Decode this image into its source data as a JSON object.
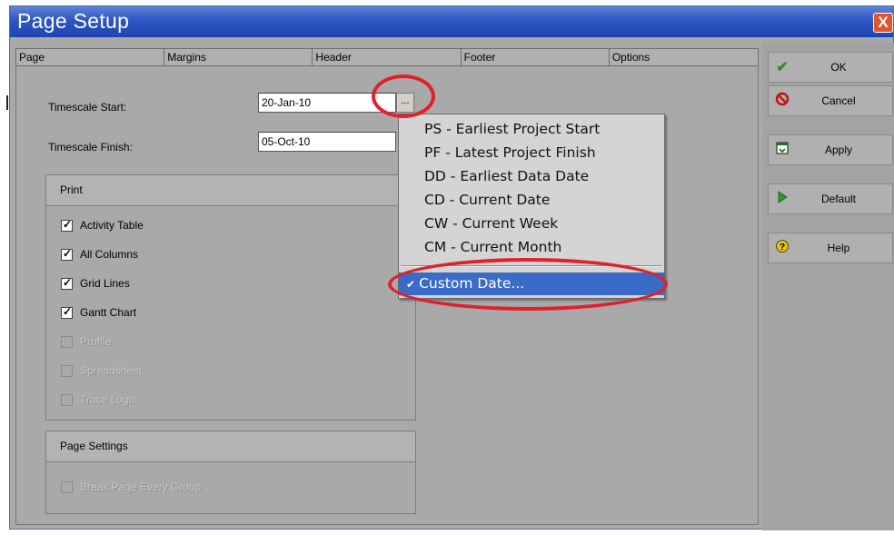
{
  "window": {
    "title": "Page Setup",
    "close_label": "X"
  },
  "tabs": [
    {
      "label": "Page"
    },
    {
      "label": "Margins"
    },
    {
      "label": "Header"
    },
    {
      "label": "Footer"
    },
    {
      "label": "Options"
    }
  ],
  "timescale": {
    "start_label": "Timescale Start:",
    "start_value": "20-Jan-10",
    "finish_label": "Timescale Finish:",
    "finish_value": "05-Oct-10",
    "ellipsis_label": "..."
  },
  "print_group": {
    "title": "Print",
    "items": [
      {
        "label": "Activity Table",
        "checked": true,
        "enabled": true
      },
      {
        "label": "All Columns",
        "checked": true,
        "enabled": true
      },
      {
        "label": "Grid Lines",
        "checked": true,
        "enabled": true
      },
      {
        "label": "Gantt Chart",
        "checked": true,
        "enabled": true
      },
      {
        "label": "Profile",
        "checked": false,
        "enabled": false
      },
      {
        "label": "Spreadsheet",
        "checked": false,
        "enabled": false
      },
      {
        "label": "Trace Logic",
        "checked": false,
        "enabled": false
      }
    ]
  },
  "page_settings_group": {
    "title": "Page Settings",
    "items": [
      {
        "label": "Break Page Every Group",
        "checked": false,
        "enabled": false
      }
    ]
  },
  "side_buttons": {
    "ok": {
      "label": "OK",
      "icon": "checkmark-icon",
      "color": "#2e8b2e"
    },
    "cancel": {
      "label": "Cancel",
      "icon": "cancel-icon",
      "color": "#c0141a"
    },
    "apply": {
      "label": "Apply",
      "icon": "apply-icon",
      "color": "#1f6f2f"
    },
    "default": {
      "label": "Default",
      "icon": "play-icon",
      "color": "#2e9a2e"
    },
    "help": {
      "label": "Help",
      "icon": "help-icon",
      "color": "#e3c21a"
    }
  },
  "date_menu": {
    "items": [
      {
        "label": "PS - Earliest Project Start"
      },
      {
        "label": "PF - Latest Project Finish"
      },
      {
        "label": "DD - Earliest Data Date"
      },
      {
        "label": "CD - Current Date"
      },
      {
        "label": "CW - Current Week"
      },
      {
        "label": "CM - Current Month"
      }
    ],
    "selected": {
      "label": "Custom Date...",
      "check": "✔"
    }
  },
  "annotation_color": "#e0212a"
}
